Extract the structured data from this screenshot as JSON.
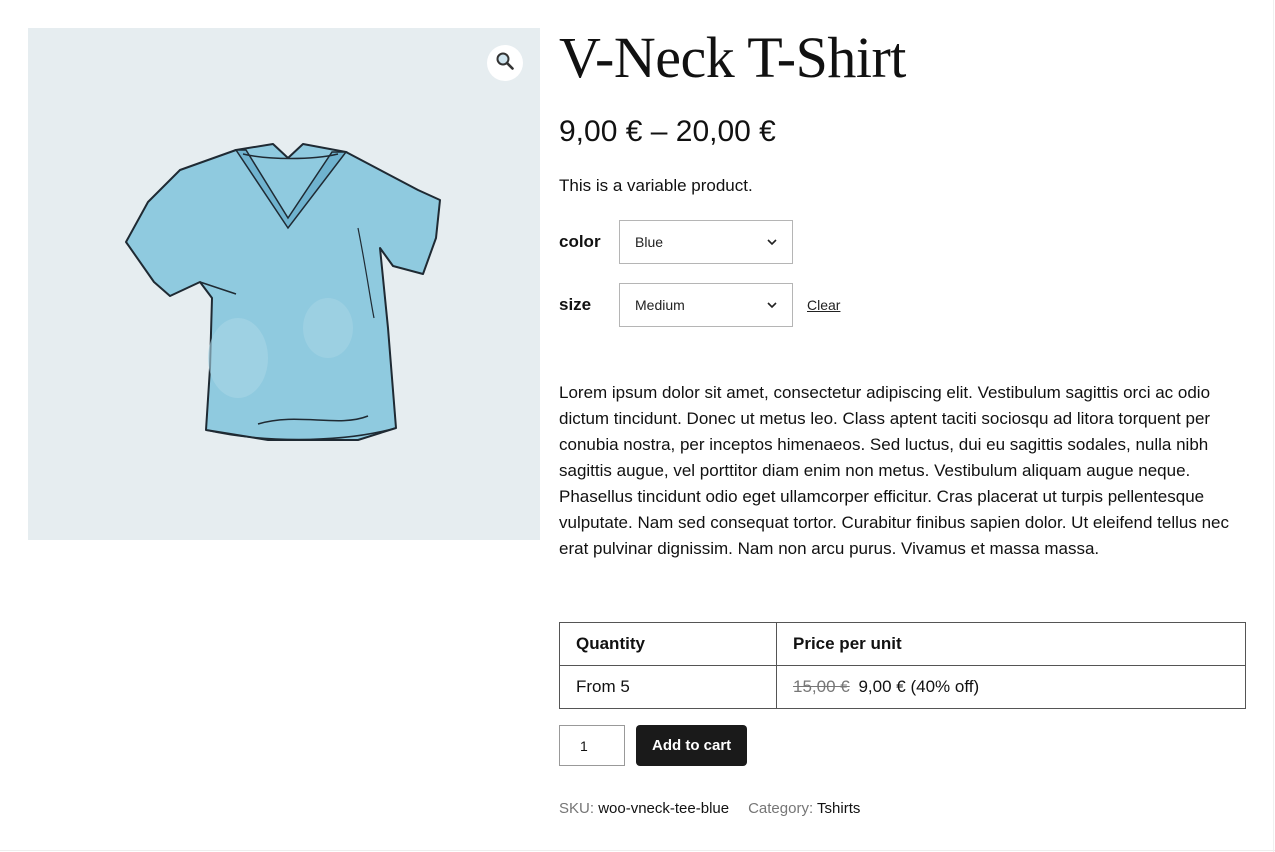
{
  "product": {
    "title": "V-Neck T-Shirt",
    "price_range": "9,00 € – 20,00 €",
    "short_description": "This is a variable product.",
    "long_description": "Lorem ipsum dolor sit amet, consectetur adipiscing elit. Vestibulum sagittis orci ac odio dictum tincidunt. Donec ut metus leo. Class aptent taciti sociosqu ad litora torquent per conubia nostra, per inceptos himenaeos. Sed luctus, dui eu sagittis sodales, nulla nibh sagittis augue, vel porttitor diam enim non metus. Vestibulum aliquam augue neque. Phasellus tincidunt odio eget ullamcorper efficitur. Cras placerat ut turpis pellentesque vulputate. Nam sed consequat tortor. Curabitur finibus sapien dolor. Ut eleifend tellus nec erat pulvinar dignissim. Nam non arcu purus. Vivamus et massa massa."
  },
  "gallery": {
    "zoom_icon": "magnifier-icon",
    "image_color": "#8cc8dd"
  },
  "variations": {
    "color": {
      "label": "color",
      "selected": "Blue"
    },
    "size": {
      "label": "size",
      "selected": "Medium"
    },
    "clear_label": "Clear"
  },
  "tiers": {
    "headers": [
      "Quantity",
      "Price per unit"
    ],
    "rows": [
      {
        "quantity": "From 5",
        "old_price": "15,00 €",
        "new_price": "9,00 €",
        "discount": "(40% off)"
      }
    ]
  },
  "cart": {
    "quantity": "1",
    "add_label": "Add to cart"
  },
  "meta": {
    "sku_label": "SKU:",
    "sku_value": "woo-vneck-tee-blue",
    "category_label": "Category:",
    "category_value": "Tshirts"
  }
}
